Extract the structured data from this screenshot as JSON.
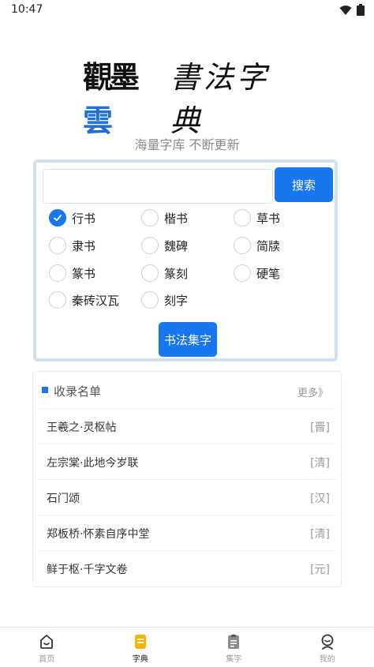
{
  "status_bar": {
    "time": "10:47"
  },
  "logo": {
    "seal_text": "觀墨",
    "seal_blue": "雲",
    "text": "書法字典"
  },
  "slogan": "海量字库 不断更新",
  "search": {
    "value": "",
    "placeholder": "",
    "button_label": "搜索"
  },
  "options": [
    {
      "label": "行书",
      "checked": true
    },
    {
      "label": "楷书",
      "checked": false
    },
    {
      "label": "草书",
      "checked": false
    },
    {
      "label": "隶书",
      "checked": false
    },
    {
      "label": "魏碑",
      "checked": false
    },
    {
      "label": "简牍",
      "checked": false
    },
    {
      "label": "篆书",
      "checked": false
    },
    {
      "label": "篆刻",
      "checked": false
    },
    {
      "label": "硬笔",
      "checked": false
    },
    {
      "label": "秦砖汉瓦",
      "checked": false
    },
    {
      "label": "刻字",
      "checked": false
    }
  ],
  "collect_button_label": "书法集字",
  "collection": {
    "title": "收录名单",
    "more_label": "更多》",
    "items": [
      {
        "name": "王羲之·灵枢帖",
        "dynasty": "[晋]"
      },
      {
        "name": "左宗棠·此地今岁联",
        "dynasty": "[清]"
      },
      {
        "name": "石门颂",
        "dynasty": "[汉]"
      },
      {
        "name": "郑板桥·怀素自序中堂",
        "dynasty": "[清]"
      },
      {
        "name": "鲜于枢·千字文卷",
        "dynasty": "[元]"
      }
    ]
  },
  "tabbar": {
    "tabs": [
      {
        "label": "首页",
        "icon": "home-icon",
        "active": false
      },
      {
        "label": "字典",
        "icon": "dictionary-icon",
        "active": true
      },
      {
        "label": "集字",
        "icon": "clipboard-icon",
        "active": false
      },
      {
        "label": "我的",
        "icon": "profile-icon",
        "active": false
      }
    ]
  },
  "colors": {
    "accent": "#1677f0",
    "active_tab_icon": "#f5b400",
    "panel_border": "#cfe0f1"
  }
}
